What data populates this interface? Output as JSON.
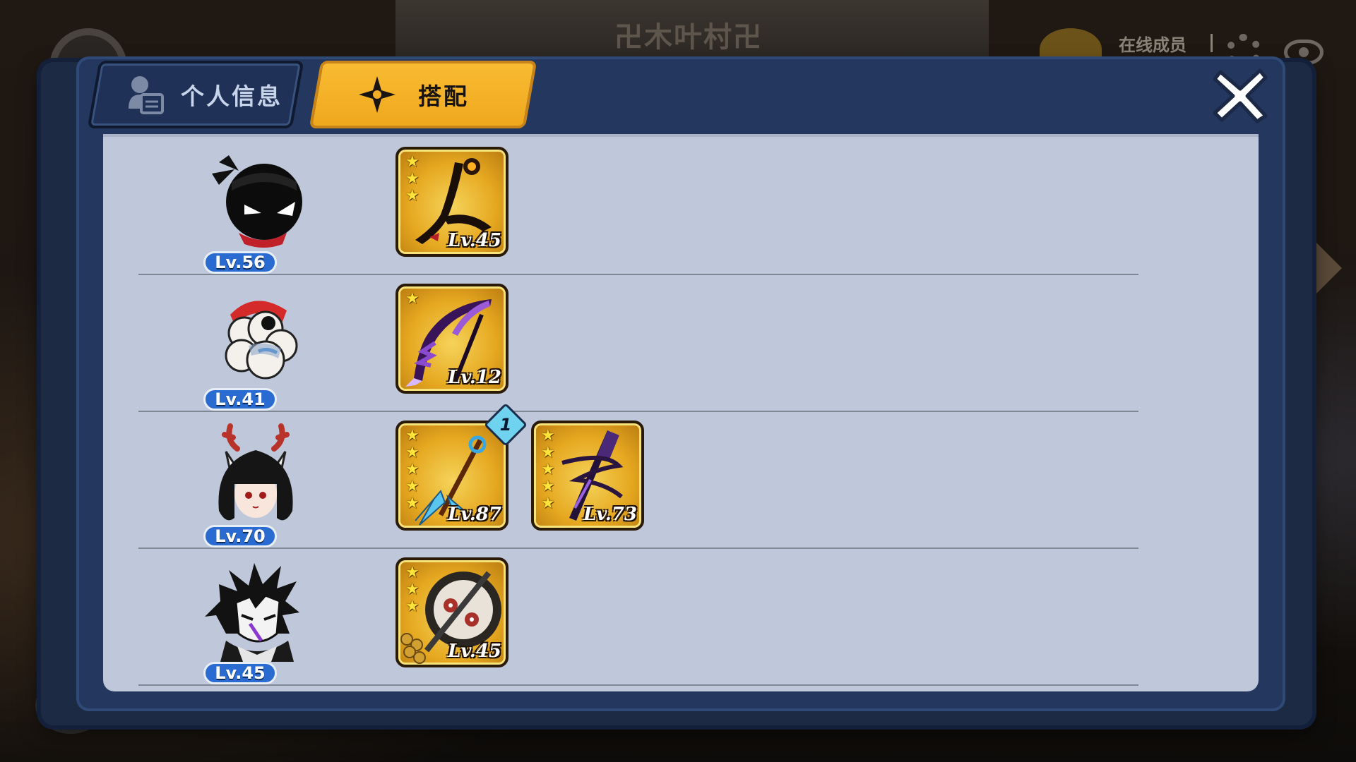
{
  "background": {
    "village_title": "卍木叶村卍",
    "online_members_label": "在线成员"
  },
  "tabs": [
    {
      "label": "个人信息",
      "icon": "profile-card-icon",
      "active": false
    },
    {
      "label": "搭配",
      "icon": "shuriken-icon",
      "active": true
    }
  ],
  "close_icon": "close-x-icon",
  "colors": {
    "active_tab": "#f5b22a",
    "panel": "#bfc8da",
    "frame": "#24375f",
    "level_badge": "#2a6bd1"
  },
  "loadout": [
    {
      "hero": {
        "name_icon": "black-ninja-avatar",
        "level": "Lv.56"
      },
      "weapons": [
        {
          "icon": "dark-scythe-weapon-icon",
          "stars": 3,
          "level": "Lv.45"
        }
      ]
    },
    {
      "hero": {
        "name_icon": "white-sheep-ninja-avatar",
        "level": "Lv.41"
      },
      "weapons": [
        {
          "icon": "purple-scythe-weapon-icon",
          "stars": 1,
          "level": "Lv.12"
        }
      ]
    },
    {
      "hero": {
        "name_icon": "antler-girl-avatar",
        "level": "Lv.70"
      },
      "weapons": [
        {
          "icon": "blue-spear-weapon-icon",
          "stars": 5,
          "level": "Lv.87",
          "refine": "1"
        },
        {
          "icon": "purple-katana-weapon-icon",
          "stars": 5,
          "level": "Lv.73"
        }
      ]
    },
    {
      "hero": {
        "name_icon": "fox-mask-ninja-avatar",
        "level": "Lv.45"
      },
      "weapons": [
        {
          "icon": "tomoe-shield-weapon-icon",
          "stars": 3,
          "level": "Lv.45"
        }
      ]
    }
  ]
}
